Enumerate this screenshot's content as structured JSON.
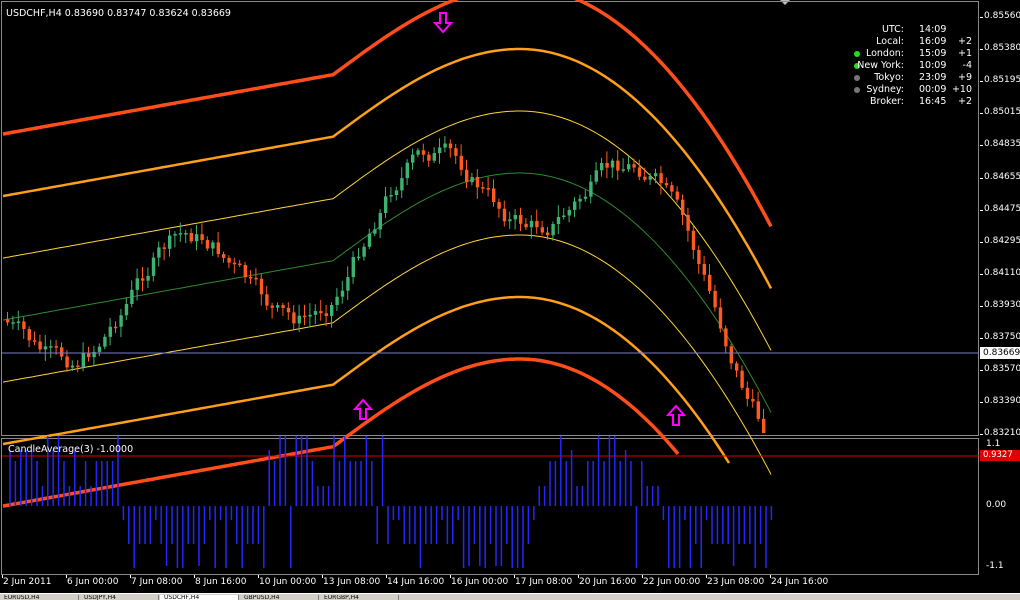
{
  "chart": {
    "symbol_line": "USDCHF,H4  0.83690 0.83747 0.83624 0.83669",
    "current_price": "0.83669",
    "price_labels": [
      "0.85560",
      "0.85380",
      "0.85195",
      "0.85015",
      "0.84835",
      "0.84655",
      "0.84475",
      "0.84295",
      "0.84110",
      "0.83930",
      "0.83750",
      "0.83570",
      "0.83390",
      "0.83210"
    ],
    "time_labels": [
      "2 Jun 2011",
      "6 Jun 00:00",
      "7 Jun 08:00",
      "8 Jun 16:00",
      "10 Jun 00:00",
      "13 Jun 08:00",
      "14 Jun 16:00",
      "16 Jun 00:00",
      "17 Jun 08:00",
      "20 Jun 16:00",
      "22 Jun 00:00",
      "23 Jun 08:00",
      "24 Jun 16:00"
    ],
    "colors": {
      "bull": "#3cb371",
      "bear": "#ff5a1f",
      "band_outer": "#ff4e1a",
      "band_mid": "#ff9f1a",
      "band_inner": "#ffd43a",
      "band_center": "#2e8b2e",
      "arrow": "#ff00ff",
      "histogram": "#2525ff",
      "indicator_level": "#e00000"
    },
    "arrows": [
      {
        "icon": "arrow-down-icon"
      },
      {
        "icon": "arrow-up-icon"
      },
      {
        "icon": "arrow-up-icon"
      }
    ]
  },
  "clock": {
    "header_label": "UTC:",
    "header_time": "14:09",
    "rows": [
      {
        "city": "Local:",
        "time": "16:09",
        "offset": "+2",
        "dot": ""
      },
      {
        "city": "London:",
        "time": "15:09",
        "offset": "+1",
        "dot": "#22dd22"
      },
      {
        "city": "New York:",
        "time": "10:09",
        "offset": "-4",
        "dot": "#22dd22"
      },
      {
        "city": "Tokyo:",
        "time": "23:09",
        "offset": "+9",
        "dot": "#777777"
      },
      {
        "city": "Sydney:",
        "time": "00:09",
        "offset": "+10",
        "dot": "#777777"
      },
      {
        "city": "Broker:",
        "time": "16:45",
        "offset": "+2",
        "dot": ""
      }
    ]
  },
  "indicator": {
    "title": "CandleAverage(3) -1.0000",
    "axis_labels": [
      "1.1",
      "0.00",
      "-1.1"
    ],
    "level_label": "0.9327"
  },
  "tabs": [
    "EURUSD,H4",
    "USDJPY,H4",
    "USDCHF,H4",
    "GBPUSD,H4",
    "EURGBP,H4"
  ]
}
